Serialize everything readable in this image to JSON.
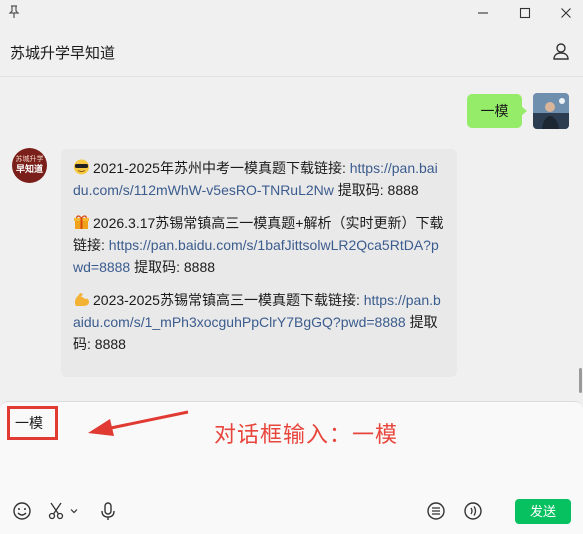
{
  "chat": {
    "title": "苏城升学早知道"
  },
  "messages": {
    "sent_text": "一模",
    "bot_avatar": {
      "line1": "苏城升学",
      "line2": "早知道"
    },
    "blocks": [
      {
        "emoji": "sunglasses-emoji",
        "text": "2021-2025年苏州中考一模真题下载链接: ",
        "link": "https://pan.baidu.com/s/112mWhW-v5esRO-TNRuL2Nw",
        "suffix": " 提取码: 8888"
      },
      {
        "emoji": "gift-emoji",
        "text": "2026.3.17苏锡常镇高三一模真题+解析（实时更新）下载链接: ",
        "link": "https://pan.baidu.com/s/1bafJittsolwLR2Qca5RtDA?pwd=8888",
        "suffix": " 提取码: 8888"
      },
      {
        "emoji": "flexed-biceps-emoji",
        "text": "2023-2025苏锡常镇高三一模真题下载链接: ",
        "link": "https://pan.baidu.com/s/1_mPh3xocguhPpClrY7BgGQ?pwd=8888",
        "suffix": " 提取码: 8888"
      }
    ]
  },
  "composer": {
    "value": "一模",
    "annotation": "对话框输入：一模",
    "send_label": "发送"
  },
  "colors": {
    "sent_bubble": "#95ec69",
    "send_button": "#07c160",
    "link": "#3b5c8e",
    "annotation_red": "#e03a32"
  }
}
